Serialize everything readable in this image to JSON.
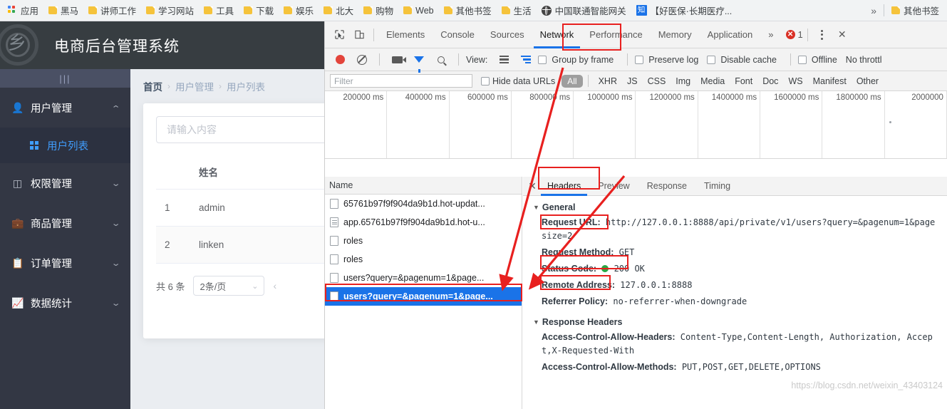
{
  "bookmarks": {
    "apps_label": "应用",
    "items": [
      {
        "label": "黑马",
        "icon": "folder-icon"
      },
      {
        "label": "讲师工作",
        "icon": "folder-icon"
      },
      {
        "label": "学习网站",
        "icon": "folder-icon"
      },
      {
        "label": "工具",
        "icon": "folder-icon"
      },
      {
        "label": "下载",
        "icon": "folder-icon"
      },
      {
        "label": "娱乐",
        "icon": "folder-icon"
      },
      {
        "label": "北大",
        "icon": "folder-icon"
      },
      {
        "label": "购物",
        "icon": "folder-icon"
      },
      {
        "label": "Web",
        "icon": "folder-icon"
      },
      {
        "label": "其他书签",
        "icon": "folder-icon"
      },
      {
        "label": "生活",
        "icon": "folder-icon"
      },
      {
        "label": "中国联通智能网关",
        "icon": "globe-icon"
      },
      {
        "label": "【好医保·长期医疗...",
        "icon": "zhihu-icon"
      }
    ],
    "overflow_label": "»",
    "other_bookmarks_label": "其他书签"
  },
  "app": {
    "title": "电商后台管理系统",
    "collapse_label": "|||",
    "menu": [
      {
        "label": "用户管理",
        "icon": "user-icon",
        "expanded": true,
        "arrow": "^"
      },
      {
        "label": "权限管理",
        "icon": "shield-icon",
        "expanded": false,
        "arrow": "v"
      },
      {
        "label": "商品管理",
        "icon": "goods-icon",
        "expanded": false,
        "arrow": "v"
      },
      {
        "label": "订单管理",
        "icon": "order-icon",
        "expanded": false,
        "arrow": "v"
      },
      {
        "label": "数据统计",
        "icon": "chart-icon",
        "expanded": false,
        "arrow": "v"
      }
    ],
    "submenu": {
      "label": "用户列表",
      "icon": "grid-icon"
    },
    "breadcrumb": [
      "首页",
      "用户管理",
      "用户列表"
    ],
    "breadcrumb_sep": "›",
    "search_placeholder": "请输入内容",
    "table": {
      "columns": [
        "",
        "姓名"
      ],
      "rows": [
        {
          "index": "1",
          "name": "admin"
        },
        {
          "index": "2",
          "name": "linken"
        }
      ]
    },
    "pagination": {
      "total_label": "共 6 条",
      "page_size": "2条/页",
      "prev_label": "‹"
    }
  },
  "devtools": {
    "tabs": [
      "Elements",
      "Console",
      "Sources",
      "Network",
      "Performance",
      "Memory",
      "Application"
    ],
    "active_tab": "Network",
    "more_tabs_label": "»",
    "error_count": "1",
    "close_label": "✕",
    "toolbar": {
      "record_icon": "record-icon",
      "clear_icon": "clear-icon",
      "camera_icon": "camera-icon",
      "filter_icon": "funnel-icon",
      "search_icon": "search-icon",
      "view_label": "View:",
      "list_icon": "list-view-icon",
      "waterfall_icon": "waterfall-view-icon",
      "group_by_frame": "Group by frame",
      "preserve_log": "Preserve log",
      "disable_cache": "Disable cache",
      "offline": "Offline",
      "throttling": "No throttl"
    },
    "filterbar": {
      "filter_placeholder": "Filter",
      "hide_data_urls": "Hide data URLs",
      "types": [
        "All",
        "XHR",
        "JS",
        "CSS",
        "Img",
        "Media",
        "Font",
        "Doc",
        "WS",
        "Manifest",
        "Other"
      ],
      "active_type": "All"
    },
    "overview_ticks": [
      "200000 ms",
      "400000 ms",
      "600000 ms",
      "800000 ms",
      "1000000 ms",
      "1200000 ms",
      "1400000 ms",
      "1600000 ms",
      "1800000 ms",
      "2000000"
    ],
    "requests": {
      "header": "Name",
      "rows": [
        {
          "name": "65761b97f9f904da9b1d.hot-updat...",
          "icon": "file-icon",
          "selected": false
        },
        {
          "name": "app.65761b97f9f904da9b1d.hot-u...",
          "icon": "script-icon",
          "selected": false
        },
        {
          "name": "roles",
          "icon": "file-icon",
          "selected": false
        },
        {
          "name": "roles",
          "icon": "file-icon",
          "selected": false
        },
        {
          "name": "users?query=&pagenum=1&page...",
          "icon": "file-icon",
          "selected": false
        },
        {
          "name": "users?query=&pagenum=1&page...",
          "icon": "file-icon",
          "selected": true
        }
      ]
    },
    "detail": {
      "tabs": [
        "Headers",
        "Preview",
        "Response",
        "Timing"
      ],
      "active_tab": "Headers",
      "general_title": "General",
      "general": [
        {
          "key": "Request URL:",
          "value": "http://127.0.0.1:8888/api/private/v1/users?query=&pagenum=1&pagesize=2"
        },
        {
          "key": "Request Method:",
          "value": "GET"
        },
        {
          "key": "Status Code:",
          "value": "200 OK",
          "status": "green"
        },
        {
          "key": "Remote Address:",
          "value": "127.0.0.1:8888"
        },
        {
          "key": "Referrer Policy:",
          "value": "no-referrer-when-downgrade"
        }
      ],
      "response_headers_title": "Response Headers",
      "response_headers": [
        {
          "key": "Access-Control-Allow-Headers:",
          "value": "Content-Type,Content-Length, Authorization, Accept,X-Requested-With"
        },
        {
          "key": "Access-Control-Allow-Methods:",
          "value": "PUT,POST,GET,DELETE,OPTIONS"
        }
      ]
    }
  },
  "annotation_color": "#e8201f",
  "watermark": "https://blog.csdn.net/weixin_43403124"
}
